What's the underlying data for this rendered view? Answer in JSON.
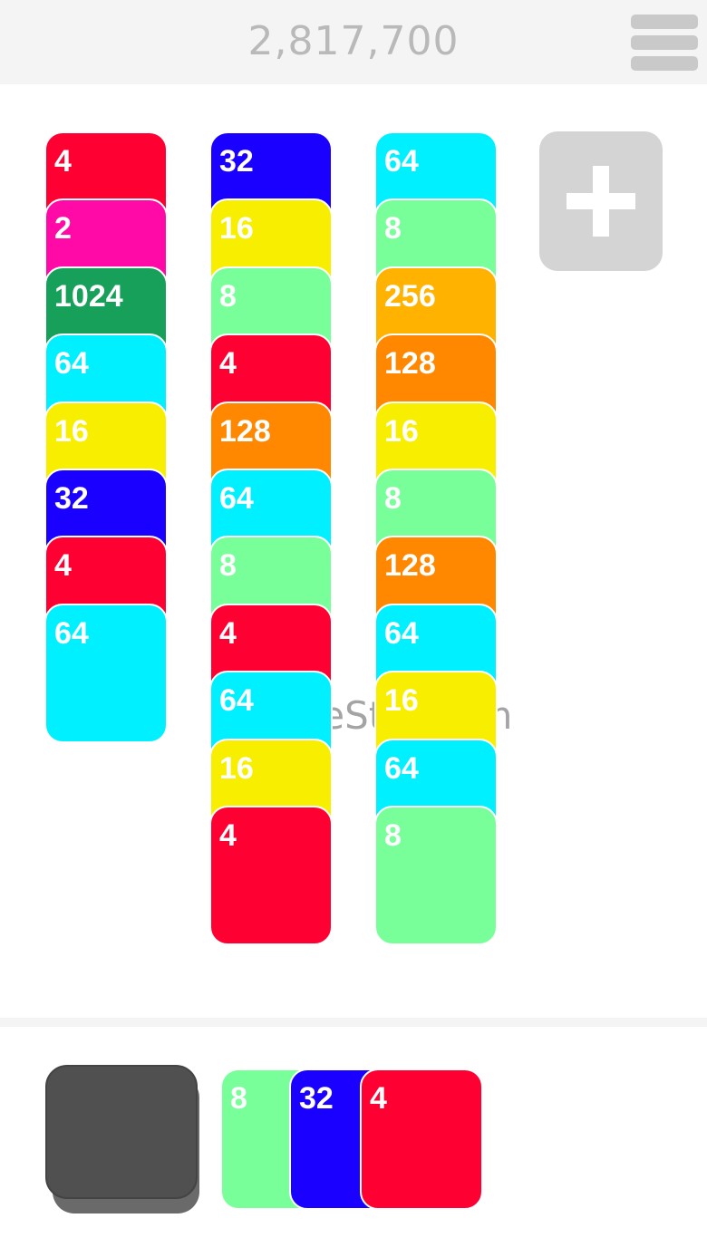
{
  "header": {
    "score": "2,817,700",
    "menu_icon": "hamburger-menu-icon"
  },
  "columns": [
    [
      "4",
      "2",
      "1024",
      "64",
      "16",
      "32",
      "4",
      "64"
    ],
    [
      "32",
      "16",
      "8",
      "4",
      "128",
      "64",
      "8",
      "4",
      "64",
      "16",
      "4"
    ],
    [
      "64",
      "8",
      "256",
      "128",
      "16",
      "8",
      "128",
      "64",
      "16",
      "64",
      "8"
    ]
  ],
  "add_button": {
    "icon": "plus-icon"
  },
  "watermark": "UpdateStar.com",
  "tray": {
    "deck_icon": "card-deck-icon",
    "hand": [
      "8",
      "32",
      "4"
    ]
  },
  "colors": {
    "2": "#ff0aa6",
    "4": "#ff0033",
    "8": "#78ff9a",
    "16": "#f8ef00",
    "32": "#1a00ff",
    "64": "#00f0ff",
    "128": "#ff8800",
    "256": "#ffb300",
    "1024": "#16a05a"
  }
}
